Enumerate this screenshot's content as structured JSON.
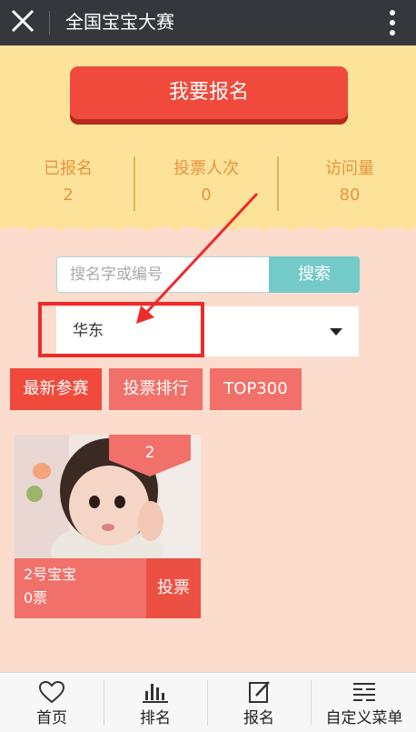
{
  "window": {
    "title": "全国宝宝大赛"
  },
  "signup_button": "我要报名",
  "stats": [
    {
      "label": "已报名",
      "value": "2"
    },
    {
      "label": "投票人次",
      "value": "0"
    },
    {
      "label": "访问量",
      "value": "80"
    }
  ],
  "search": {
    "placeholder": "搜名字或编号",
    "button": "搜索"
  },
  "region": {
    "selected": "华东"
  },
  "tabs": [
    "最新参赛",
    "投票排行",
    "TOP300"
  ],
  "entry": {
    "number": "2",
    "name": "2号宝宝",
    "votes": "0票",
    "vote_button": "投票"
  },
  "nav": [
    {
      "label": "首页",
      "icon": "heart-icon"
    },
    {
      "label": "排名",
      "icon": "bar-chart-icon"
    },
    {
      "label": "报名",
      "icon": "edit-icon"
    },
    {
      "label": "自定义菜单",
      "icon": "menu-list-icon"
    }
  ],
  "colors": {
    "accent": "#ef4a3b",
    "header": "#35373d",
    "banner": "#fde39a",
    "background": "#fcdccd",
    "search_button": "#74c9c9",
    "annotation": "#ec2b2b"
  }
}
